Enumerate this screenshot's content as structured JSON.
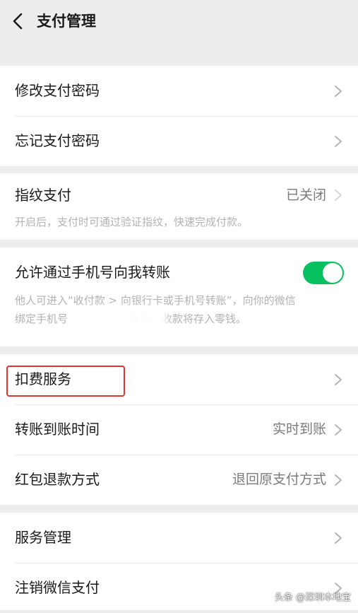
{
  "nav": {
    "title": "支付管理",
    "back_icon": "chevron-left-icon"
  },
  "password": {
    "change_label": "修改支付密码",
    "forgot_label": "忘记支付密码"
  },
  "fingerprint": {
    "label": "指纹支付",
    "value": "已关闭",
    "description": "开启后，支付时可通过验证指纹，快速完成付款。"
  },
  "phone_transfer": {
    "label": "允许通过手机号向我转账",
    "enabled": true,
    "description_line1": "他人可进入“收付款 > 向银行卡或手机号转账”，向你的微信",
    "description_line2_prefix": "绑定手机号",
    "description_line2_suffix": "转账，收款将存入零钱。"
  },
  "services": {
    "deduction_label": "扣费服务",
    "transfer_time_label": "转账到账时间",
    "transfer_time_value": "实时到账",
    "refund_label": "红包退款方式",
    "refund_value": "退回原支付方式"
  },
  "manage": {
    "service_manage_label": "服务管理",
    "cancel_pay_label": "注销微信支付"
  },
  "watermark": "头条 @深圳本地宝",
  "colors": {
    "background": "#ededed",
    "card": "#ffffff",
    "toggle_on": "#07c160",
    "highlight": "#e03434",
    "secondary_text": "#7a7a7a",
    "hint_text": "#b2b2b2"
  }
}
